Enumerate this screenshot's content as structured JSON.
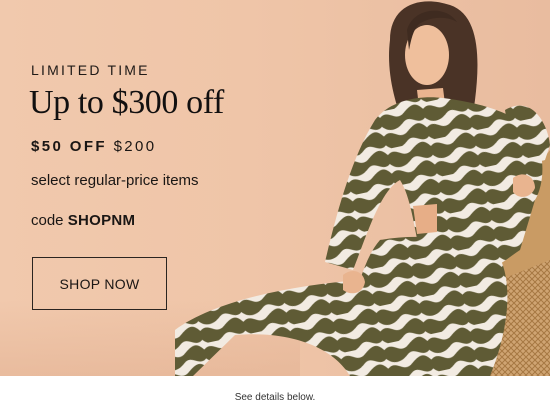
{
  "promo": {
    "eyebrow": "LIMITED TIME",
    "headline": "Up to $300 off",
    "offer_bold": "$50 OFF",
    "offer_rest": " $200",
    "subline": "select regular-price items",
    "code_label": "code ",
    "code_value": "SHOPNM",
    "cta_label": "SHOP NOW"
  },
  "footer": {
    "note": "See details below."
  },
  "colors": {
    "background": "#efc5a8",
    "text": "#1a1614",
    "print_dark": "#5e5a34",
    "print_light": "#f3ece3",
    "chair": "#c99b64"
  }
}
